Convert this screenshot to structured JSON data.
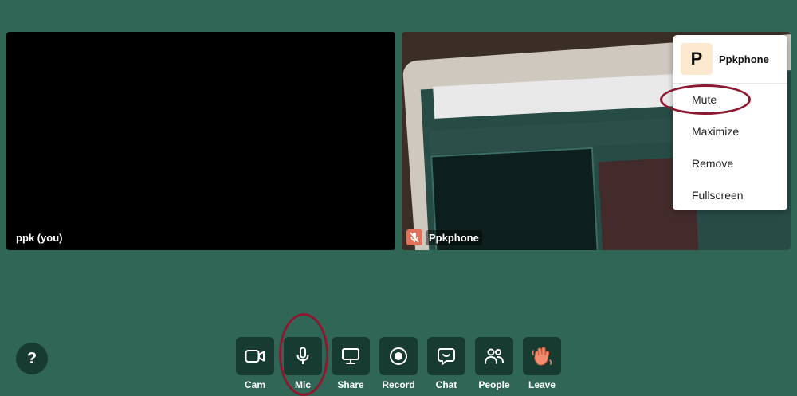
{
  "tiles": {
    "self_label": "ppk (you)",
    "remote_label": "Ppkphone"
  },
  "context_menu": {
    "avatar_letter": "P",
    "name": "Ppkphone",
    "items": [
      "Mute",
      "Maximize",
      "Remove",
      "Fullscreen"
    ]
  },
  "help": {
    "label": "?"
  },
  "toolbar": {
    "items": [
      {
        "label": "Cam",
        "icon": "camera-icon"
      },
      {
        "label": "Mic",
        "icon": "microphone-icon"
      },
      {
        "label": "Share",
        "icon": "screen-share-icon"
      },
      {
        "label": "Record",
        "icon": "record-icon"
      },
      {
        "label": "Chat",
        "icon": "chat-icon"
      },
      {
        "label": "People",
        "icon": "people-icon"
      },
      {
        "label": "Leave",
        "icon": "waving-hand-icon"
      }
    ]
  },
  "colors": {
    "background": "#2f6656",
    "button": "#173b31",
    "annotation": "#8c1930",
    "muted_badge": "#e0725b"
  }
}
